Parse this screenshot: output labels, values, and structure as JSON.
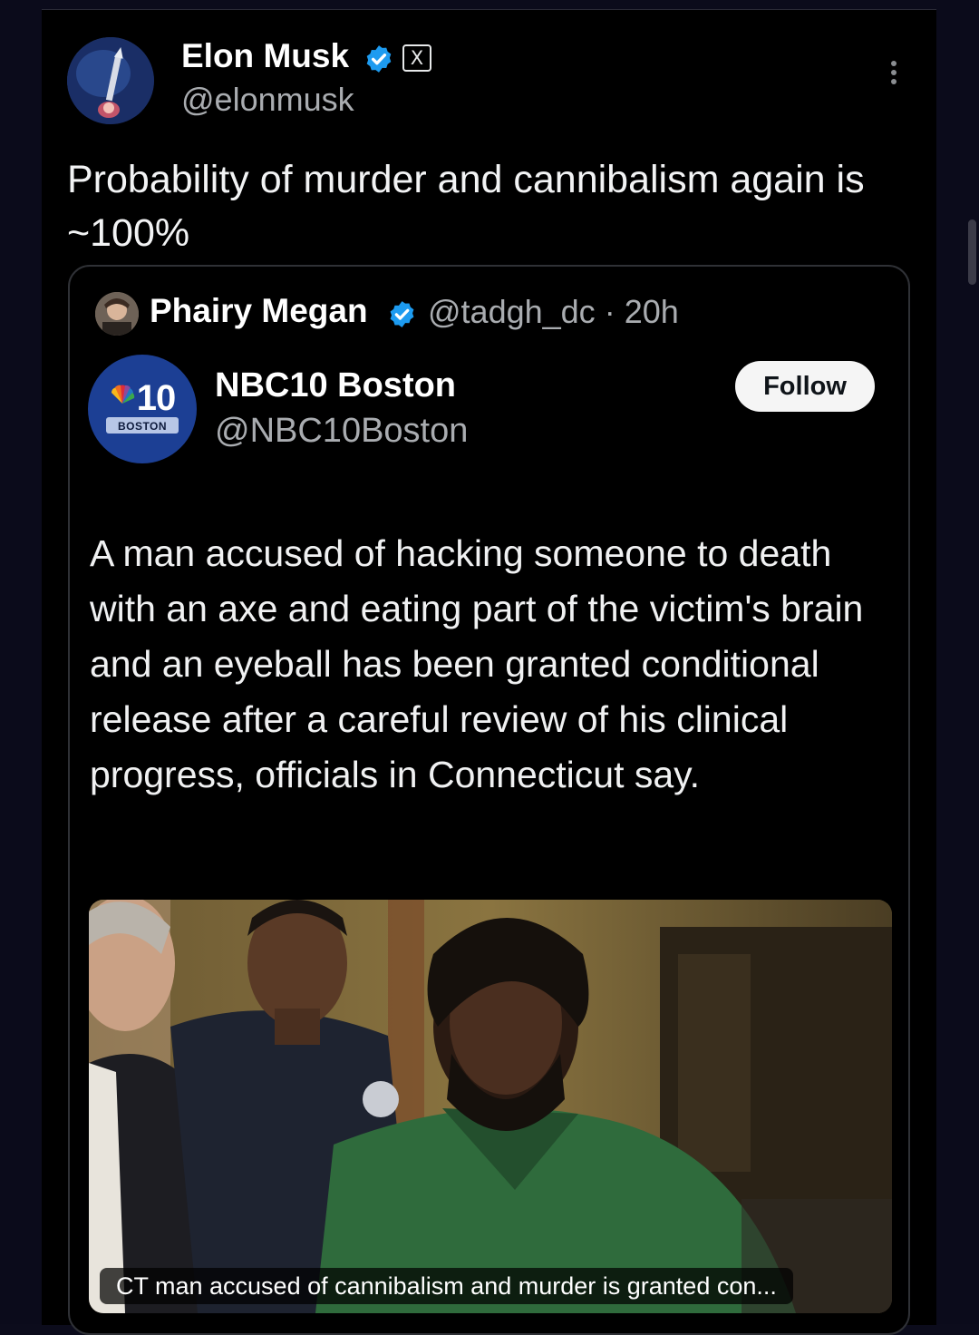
{
  "post": {
    "author_name": "Elon Musk",
    "author_handle": "@elonmusk",
    "affiliation_badge": "X",
    "text": "Probability of murder and cannibalism again is ~100%",
    "icons": {
      "verified": "verified-badge-icon",
      "more": "more-options-icon"
    },
    "colors": {
      "verified": "#1d9bf0",
      "background": "#000000"
    }
  },
  "quoted": {
    "author_name": "Phairy Megan",
    "author_handle": "@tadgh_dc",
    "separator": "·",
    "time": "20h",
    "embedded_account": {
      "name": "NBC10 Boston",
      "handle": "@NBC10Boston",
      "logo_number": "10",
      "logo_city": "BOSTON",
      "follow_label": "Follow",
      "brand_color": "#1c3f94"
    },
    "text": "A man accused of hacking someone to death with an axe and eating part of the victim's brain and an eyeball has been granted conditional release after a careful review of his clinical progress, officials in Connecticut say.",
    "media_caption": "CT man accused of cannibalism and murder is granted con..."
  }
}
